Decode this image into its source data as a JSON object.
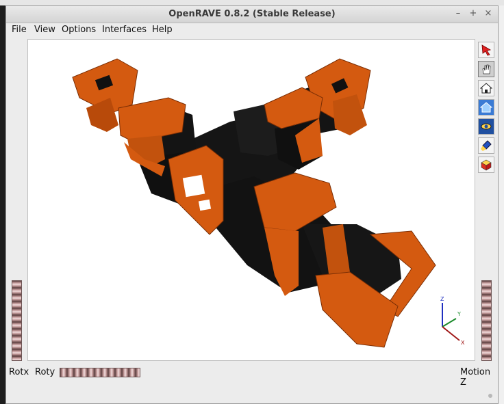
{
  "window": {
    "title": "OpenRAVE 0.8.2 (Stable Release)",
    "controls": [
      "–",
      "+",
      "×"
    ]
  },
  "menu": [
    "File",
    "View",
    "Options",
    "Interfaces",
    "Help"
  ],
  "toolbar": [
    {
      "icon": "select-arrow-icon",
      "active": false
    },
    {
      "icon": "hand-pan-icon",
      "active": true
    },
    {
      "icon": "home-icon",
      "active": false
    },
    {
      "icon": "set-home-icon",
      "active": false
    },
    {
      "icon": "view-all-eye-icon",
      "active": false
    },
    {
      "icon": "seek-flashlight-icon",
      "active": false
    },
    {
      "icon": "perspective-cube-icon",
      "active": false
    }
  ],
  "bottom": {
    "rotx_label": "Rotx",
    "roty_label": "Roty",
    "motionz_label": "Motion Z"
  },
  "axes": {
    "x": "X",
    "y": "Y",
    "z": "Z"
  },
  "colors": {
    "robot_orange": "#d45a10",
    "robot_black": "#151515",
    "axis_x": "#a01818",
    "axis_y": "#1a8a2a",
    "axis_z": "#2030c0"
  }
}
